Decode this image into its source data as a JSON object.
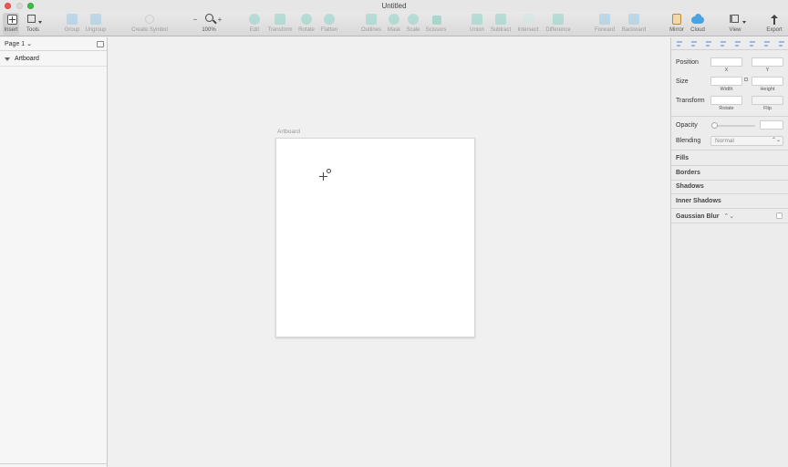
{
  "window": {
    "title": "Untitled"
  },
  "toolbar": {
    "items": [
      {
        "label": "Insert",
        "icon": "plus-square-icon"
      },
      {
        "label": "Tools",
        "icon": "tools-icon"
      },
      {
        "label": "Group",
        "icon": "group-icon"
      },
      {
        "label": "Ungroup",
        "icon": "ungroup-icon"
      },
      {
        "label": "Create Symbol",
        "icon": "create-symbol-icon"
      },
      {
        "label": "100%",
        "icon": "zoom-icon",
        "minus": "−",
        "plus": "+"
      },
      {
        "label": "Edit",
        "icon": "edit-icon"
      },
      {
        "label": "Transform",
        "icon": "transform-icon"
      },
      {
        "label": "Rotate",
        "icon": "rotate-icon"
      },
      {
        "label": "Flatten",
        "icon": "flatten-icon"
      },
      {
        "label": "Outlines",
        "icon": "outlines-icon"
      },
      {
        "label": "Mask",
        "icon": "mask-icon"
      },
      {
        "label": "Scale",
        "icon": "scale-icon"
      },
      {
        "label": "Scissors",
        "icon": "scissors-icon"
      },
      {
        "label": "Union",
        "icon": "union-icon"
      },
      {
        "label": "Subtract",
        "icon": "subtract-icon"
      },
      {
        "label": "Intersect",
        "icon": "intersect-icon"
      },
      {
        "label": "Difference",
        "icon": "difference-icon"
      },
      {
        "label": "Forward",
        "icon": "forward-icon"
      },
      {
        "label": "Backward",
        "icon": "backward-icon"
      },
      {
        "label": "Mirror",
        "icon": "mirror-icon"
      },
      {
        "label": "Cloud",
        "icon": "cloud-icon"
      },
      {
        "label": "View",
        "icon": "view-icon"
      },
      {
        "label": "Export",
        "icon": "export-icon"
      }
    ]
  },
  "pages": {
    "current": "Page 1",
    "chevron": "⌄"
  },
  "layers": [
    {
      "name": "Artboard",
      "type": "artboard",
      "expanded": true
    }
  ],
  "canvas": {
    "artboard_label": "Artboard"
  },
  "inspector": {
    "position": {
      "label": "Position",
      "x_label": "X",
      "y_label": "Y"
    },
    "size": {
      "label": "Size",
      "width_label": "Width",
      "height_label": "Height"
    },
    "transform": {
      "label": "Transform",
      "rotate_label": "Rotate",
      "flip_label": "Flip"
    },
    "opacity": {
      "label": "Opacity"
    },
    "blending": {
      "label": "Blending",
      "value": "Normal",
      "arrows": "⌃⌄"
    },
    "sections": [
      "Fills",
      "Borders",
      "Shadows",
      "Inner Shadows",
      "Gaussian Blur"
    ],
    "blur_arrows": "⌃⌄"
  },
  "colors": {
    "accent_green": "#8fd4c6",
    "accent_blue": "#9fc8e8",
    "close": "#ee5b55",
    "maximize": "#39c040"
  }
}
